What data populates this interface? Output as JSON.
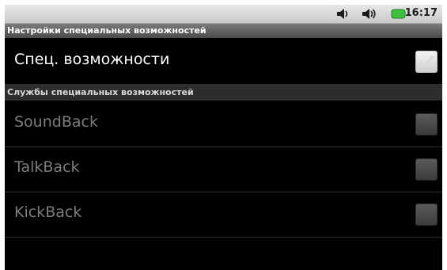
{
  "status_bar": {
    "time": "16:17",
    "icons": [
      "volume-icon",
      "volume-icon",
      "battery-icon"
    ],
    "battery_color": "#3fc13f"
  },
  "title": "Настройки специальных возможностей",
  "main_setting": {
    "label": "Спец. возможности",
    "checked": false,
    "enabled": true
  },
  "services_header": "Службы специальных возможностей",
  "services": [
    {
      "label": "SoundBack",
      "checked": false,
      "enabled": false
    },
    {
      "label": "TalkBack",
      "checked": false,
      "enabled": false
    },
    {
      "label": "KickBack",
      "checked": false,
      "enabled": false
    }
  ]
}
